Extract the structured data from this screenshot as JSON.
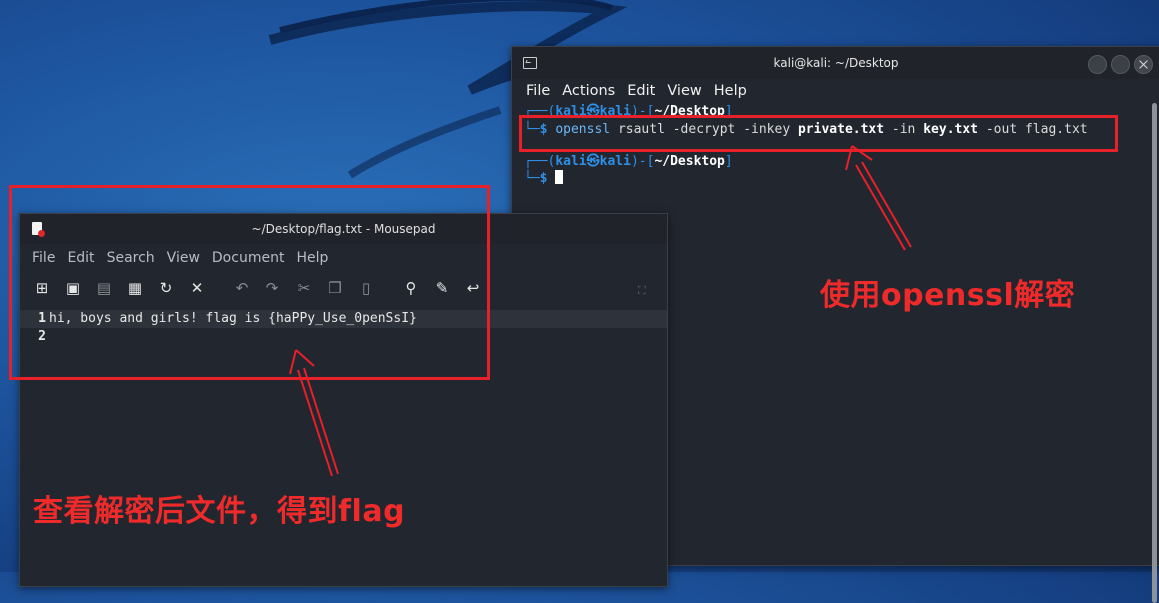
{
  "terminal": {
    "title": "kali@kali: ~/Desktop",
    "menu": [
      "File",
      "Actions",
      "Edit",
      "View",
      "Help"
    ],
    "prompt_user": "kali",
    "prompt_host": "kali",
    "prompt_dir": "~/Desktop",
    "command": {
      "cmd": "openssl",
      "arg1": "rsautl",
      "flag1": "-decrypt",
      "flag2": "-inkey",
      "keyfile": "private.txt",
      "flag3": "-in",
      "infile": "key.txt",
      "flag4": "-out",
      "outfile": "flag.txt"
    }
  },
  "mousepad": {
    "title": "~/Desktop/flag.txt - Mousepad",
    "menu": [
      "File",
      "Edit",
      "Search",
      "View",
      "Document",
      "Help"
    ],
    "lines": [
      {
        "number": "1",
        "text": "hi, boys and girls! flag is {haPPy_Use_0penSsI}"
      },
      {
        "number": "2",
        "text": ""
      }
    ]
  },
  "annotations": {
    "terminal_note": "使用openssl解密",
    "editor_note": "查看解密后文件，得到flag"
  },
  "colors": {
    "annotation_red": "#e8202a",
    "prompt_blue": "#2f8fe6",
    "terminal_bg": "#22262e"
  }
}
